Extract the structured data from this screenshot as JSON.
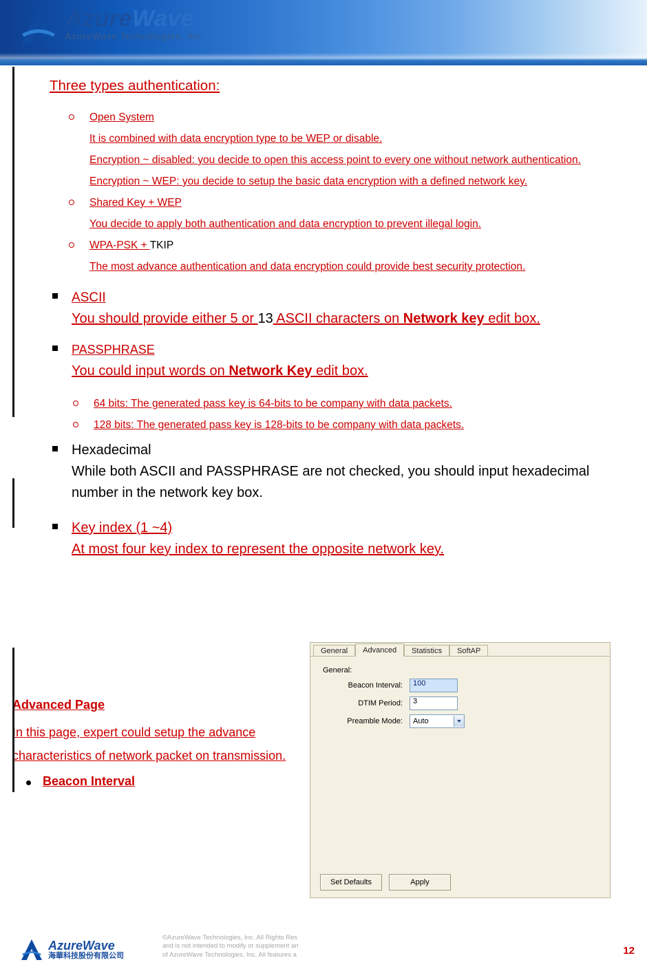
{
  "brand": {
    "name": "AzureWave",
    "tagline": "AzureWave  Technologies,  Inc."
  },
  "section_head": "Three types authentication:",
  "auth": [
    {
      "title": "Open System",
      "lines": [
        "It is combined with data encryption type to be WEP or disable.",
        "Encryption ~ disabled: you decide to open this access point to every one without network authentication.",
        "Encryption ~ WEP: you decide to setup the basic data encryption with a defined network key."
      ]
    },
    {
      "title": "Shared Key + WEP",
      "lines": [
        "You decide to apply both authentication and data encryption to prevent illegal login."
      ]
    },
    {
      "title_red": "WPA-PSK + ",
      "title_black": "TKIP",
      "lines": [
        "The most advance authentication and data encryption could provide best security protection."
      ]
    }
  ],
  "ascii": {
    "title": "ASCII",
    "pre": "You should provide either 5 or ",
    "mid": "13",
    "post1": " ASCII characters on ",
    "bold": "Network key",
    "post2": " edit box."
  },
  "pass": {
    "title": "PASSPHRASE",
    "pre": "You could input words on ",
    "bold": "Network Key",
    "post": " edit box.",
    "sub": [
      "64 bits: The generated pass key is 64-bits to be company with data packets.",
      "128 bits: The generated pass key is 128-bits to be company with data packets."
    ]
  },
  "hex": {
    "title": "Hexadecimal",
    "body": "While both ASCII and PASSPHRASE are not checked, you should input hexadecimal number in the network key box."
  },
  "keyidx": {
    "title": "Key index (1 ~4)",
    "body": "At most four key index to represent the opposite network key."
  },
  "adv": {
    "head": "Advanced Page",
    "intro": "In this page, expert could setup the advance characteristics of network packet on transmission.",
    "bullet": "Beacon Interval"
  },
  "dialog": {
    "tabs": [
      "General",
      "Advanced",
      "Statistics",
      "SoftAP"
    ],
    "active_tab": "Advanced",
    "group": "General:",
    "fields": {
      "beacon_label": "Beacon Interval:",
      "beacon_value": "100",
      "dtim_label": "DTIM Period:",
      "dtim_value": "3",
      "preamble_label": "Preamble Mode:",
      "preamble_value": "Auto"
    },
    "buttons": {
      "defaults": "Set Defaults",
      "apply": "Apply"
    }
  },
  "footer": {
    "word": "AzureWave",
    "cn": "海華科技股份有限公司",
    "copy1": "©AzureWave Technologies, Inc. All Rights Res",
    "copy2": "and is not intended to modify or supplement an",
    "copy3": "of AzureWave Technologies, Inc.  All features a",
    "pagenum": "12"
  }
}
